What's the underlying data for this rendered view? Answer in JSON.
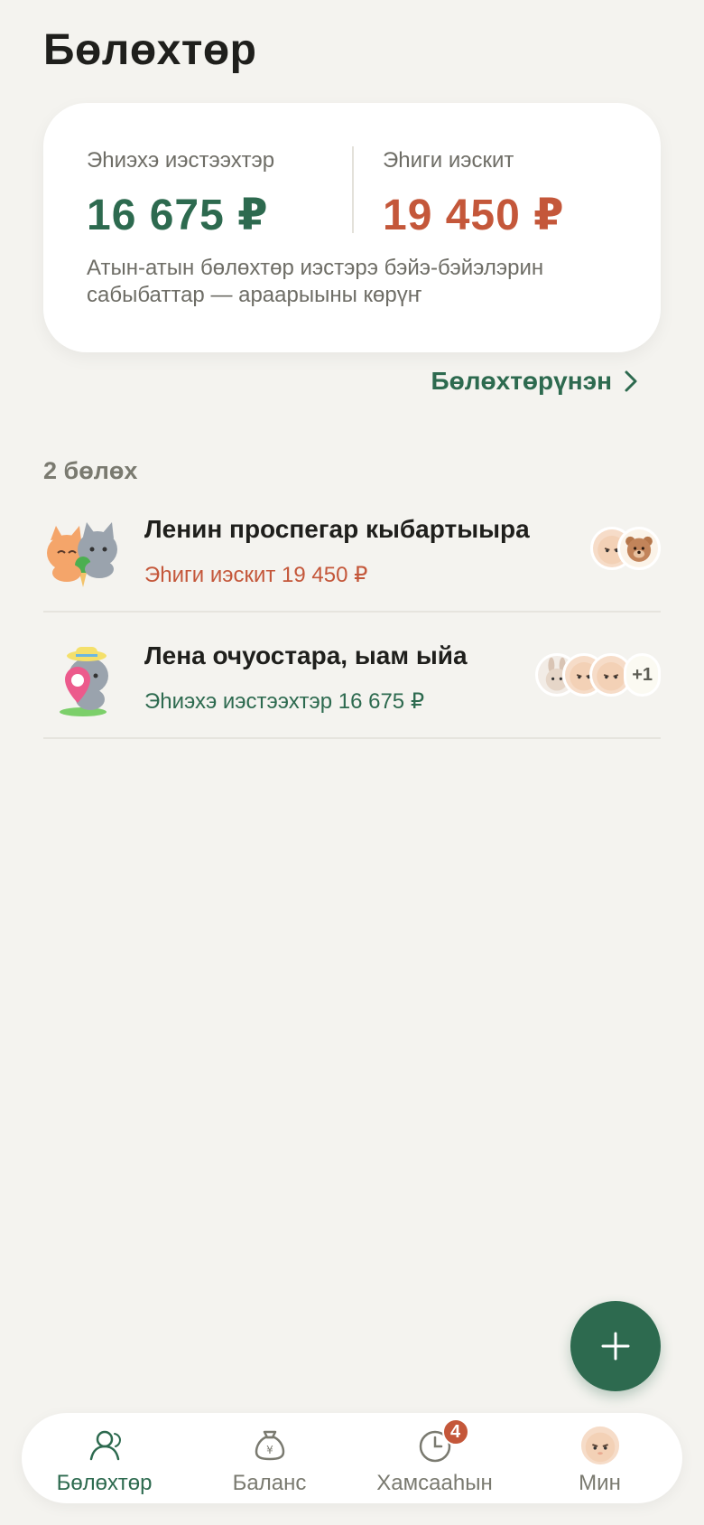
{
  "page": {
    "title": "Бөлөхтөр"
  },
  "summary": {
    "owed_to_you_label": "Эһиэхэ иэстээхтэр",
    "owed_to_you_amount": "16 675 ₽",
    "you_owe_label": "Эһиги иэскит",
    "you_owe_amount": "19 450 ₽",
    "note": "Атын-атын бөлөхтөр иэстэрэ бэйэ-бэйэлэрин сабыбаттар — араарыыны көрүҥ",
    "colors": {
      "owed_to_you": "#2d6a4f",
      "you_owe": "#c4573a"
    }
  },
  "balances_link": {
    "label": "Бөлөхтөрүнэн",
    "icon": "chevron-right-icon"
  },
  "groups": {
    "count_label": "2 бөлөх",
    "items": [
      {
        "name": "Ленин проспегар кыбартыыра",
        "status": "Эһиги иэскит 19 450 ₽",
        "status_tone": "negative",
        "avatar_icon": "cats-hugging-sticker-icon",
        "members": [
          "cat-avatar-icon",
          "bear-avatar-icon"
        ],
        "more_count": ""
      },
      {
        "name": "Лена очуостара, ыам ыйа",
        "status": "Эһиэхэ иэстээхтэр 16 675 ₽",
        "status_tone": "positive",
        "avatar_icon": "cat-with-location-pin-sticker-icon",
        "members": [
          "rabbit-avatar-icon",
          "cat-avatar-icon",
          "cat-avatar-icon"
        ],
        "more_count": "+1"
      }
    ]
  },
  "fab": {
    "icon": "plus-icon"
  },
  "tab_bar": {
    "items": [
      {
        "label": "Бөлөхтөр",
        "icon": "people-icon",
        "active": true
      },
      {
        "label": "Баланс",
        "icon": "money-bag-icon",
        "active": false
      },
      {
        "label": "Хамсааһын",
        "icon": "clock-icon",
        "active": false,
        "badge": "4"
      },
      {
        "label": "Мин",
        "icon": "profile-avatar-icon",
        "active": false
      }
    ]
  }
}
